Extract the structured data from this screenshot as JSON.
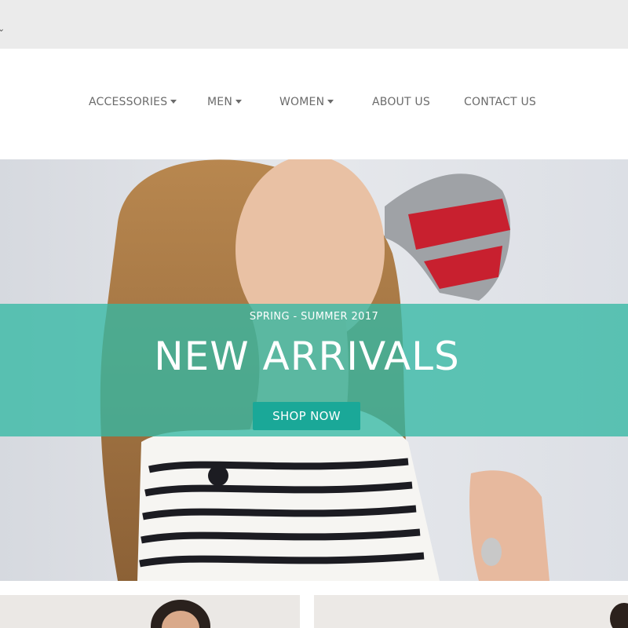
{
  "nav": {
    "items": [
      {
        "label": "ACCESSORIES",
        "dropdown": true
      },
      {
        "label": "MEN",
        "dropdown": true
      },
      {
        "label": "WOMEN",
        "dropdown": true
      },
      {
        "label": "ABOUT US",
        "dropdown": false
      },
      {
        "label": "CONTACT US",
        "dropdown": false
      }
    ]
  },
  "hero": {
    "season": "SPRING - SUMMER 2017",
    "title": "NEW ARRIVALS",
    "cta": "SHOP NOW",
    "image": "woman-striped-sweater-photo"
  },
  "colors": {
    "accent": "#34b8a4",
    "button": "#1aa898",
    "nav_text": "#6b6b6b",
    "topbar": "#ebebeb"
  },
  "icons": {
    "topbar": "chevron-down-icon",
    "nav_dropdown": "caret-down-icon"
  },
  "product_cards": [
    {
      "image": "woman-portrait-photo"
    },
    {
      "image": "model-photo"
    }
  ]
}
